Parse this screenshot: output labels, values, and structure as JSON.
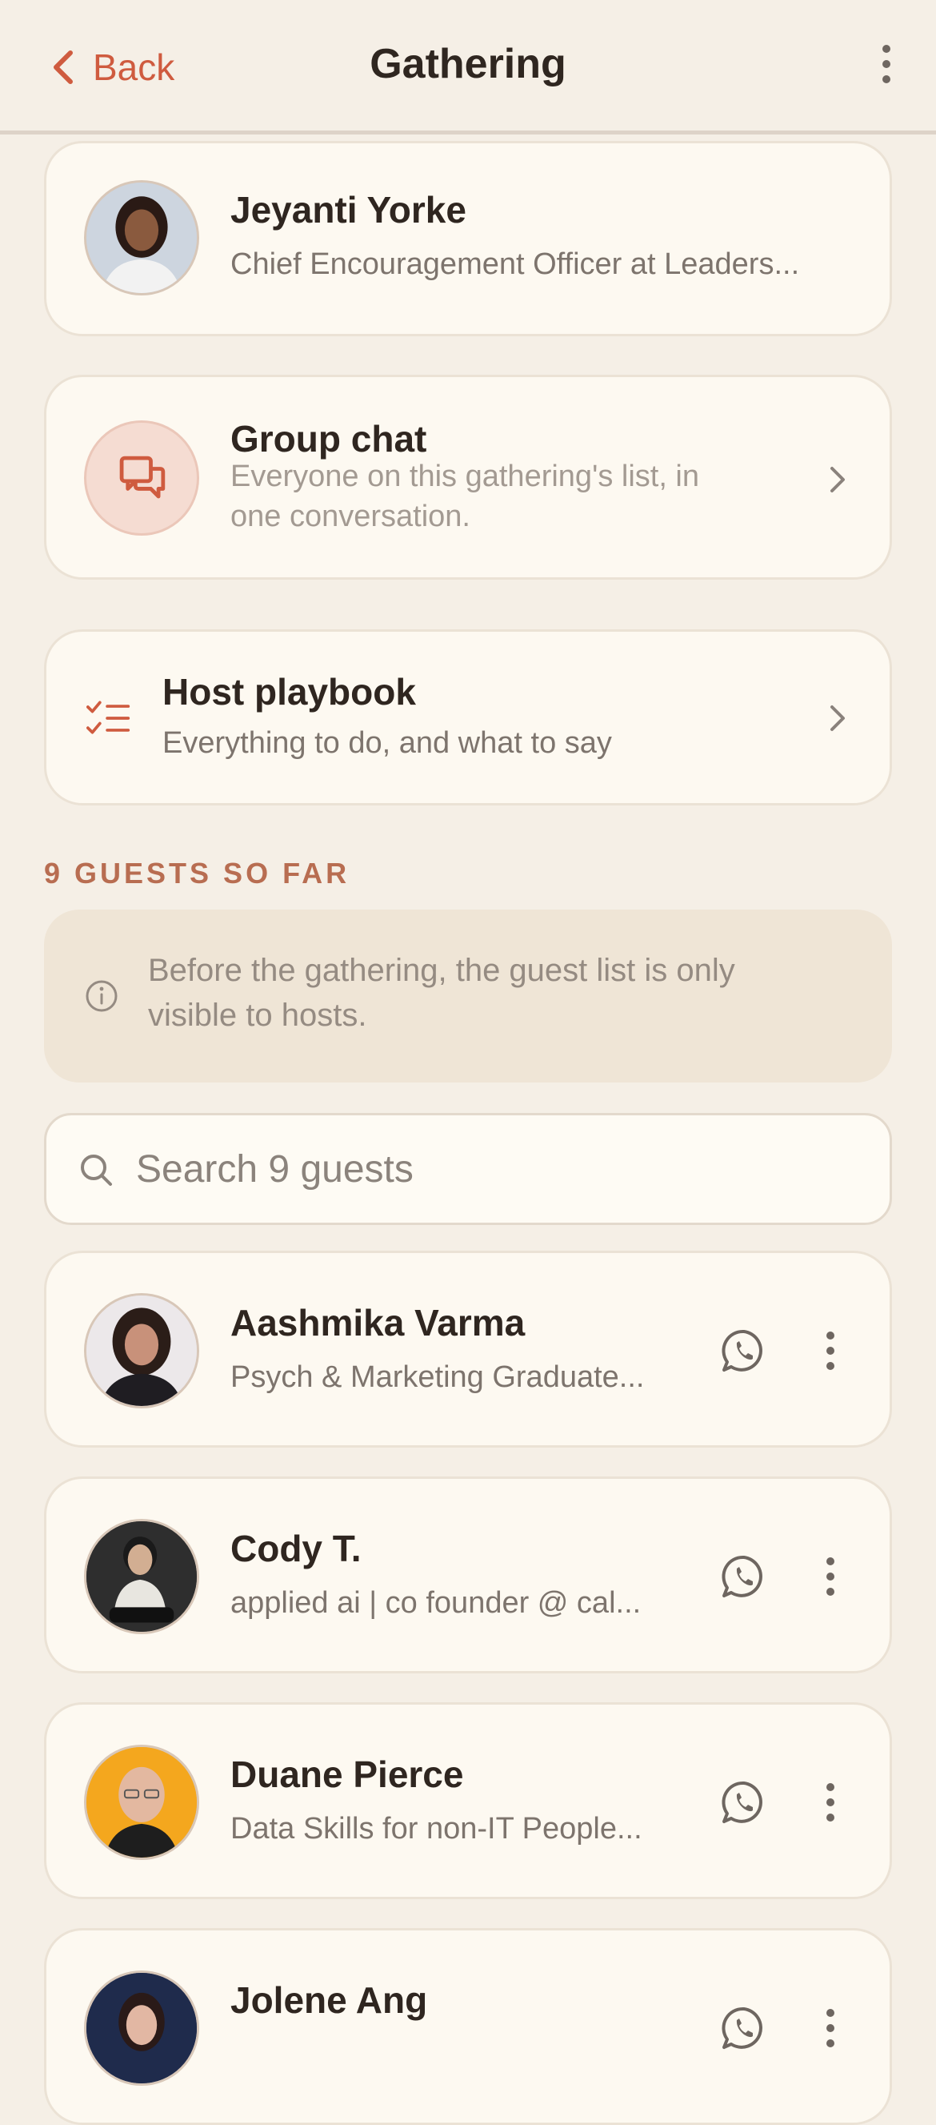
{
  "header": {
    "back_label": "Back",
    "title": "Gathering"
  },
  "host": {
    "name": "Jeyanti Yorke",
    "subtitle": "Chief Encouragement Officer at Leaders..."
  },
  "group_chat": {
    "title": "Group chat",
    "line1": "Everyone on this gathering's list, in",
    "line2": "one conversation."
  },
  "playbook": {
    "title": "Host playbook",
    "subtitle": "Everything to do, and what to say"
  },
  "guests_label": "9 GUESTS SO FAR",
  "notice": {
    "text": "Before the gathering, the guest list is only visible to hosts."
  },
  "search": {
    "placeholder": "Search 9 guests"
  },
  "guests": [
    {
      "name": "Aashmika Varma",
      "subtitle": "Psych & Marketing Graduate..."
    },
    {
      "name": "Cody T.",
      "subtitle": "applied ai | co founder @ cal..."
    },
    {
      "name": "Duane Pierce",
      "subtitle": "Data Skills for non-IT People..."
    },
    {
      "name": "Jolene Ang",
      "subtitle": ""
    }
  ],
  "colors": {
    "accent": "#cf5b3f",
    "background": "#f5efe6",
    "card": "#fdf9f1",
    "section_label": "#b86d51"
  },
  "icons": [
    "chevron-left-icon",
    "kebab-menu-icon",
    "chat-bubbles-icon",
    "checklist-icon",
    "chevron-right-icon",
    "info-icon",
    "search-icon",
    "whatsapp-icon"
  ]
}
